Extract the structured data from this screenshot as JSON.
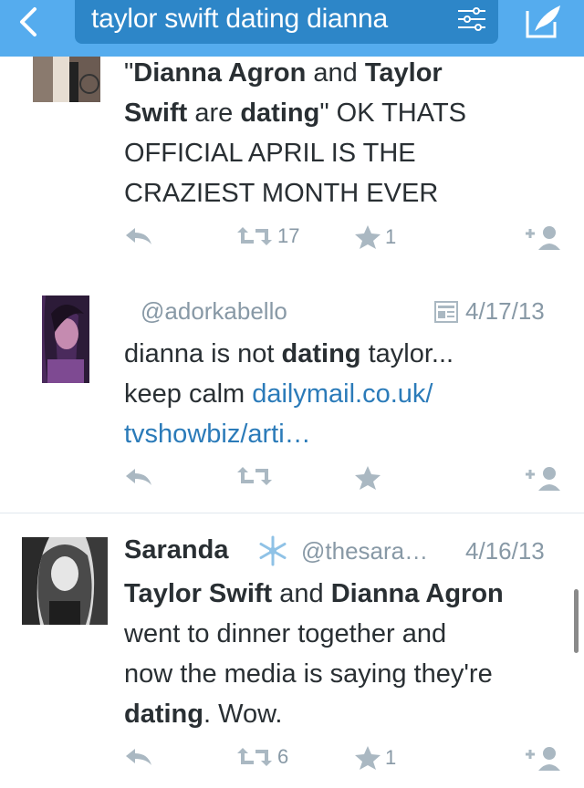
{
  "search": {
    "query": "taylor swift dating dianna"
  },
  "tweets": [
    {
      "line1_a": "\"",
      "line1_b": "Dianna Agron",
      "line1_c": " and ",
      "line1_d": "Taylor",
      "line2_a": "Swift",
      "line2_b": " are ",
      "line2_c": "dating",
      "line2_d": "\" OK THATS",
      "line3": "OFFICIAL APRIL IS THE",
      "line4": "CRAZIEST MONTH EVER",
      "retweets": "17",
      "favorites": "1"
    },
    {
      "handle": "@adorkabello",
      "date": "4/17/13",
      "line1_a": "dianna is not ",
      "line1_b": "dating",
      "line1_c": " taylor...",
      "line2_a": "keep calm ",
      "line2_link": "dailymail.co.uk/",
      "line3_link": "tvshowbiz/arti…",
      "retweets": "",
      "favorites": ""
    },
    {
      "name": "Saranda",
      "handle": "@thesara…",
      "date": "4/16/13",
      "line1_a": "Taylor Swift",
      "line1_b": " and ",
      "line1_c": "Dianna Agron",
      "line2": "went to dinner together and",
      "line3": "now the media is saying they're",
      "line4_a": "dating",
      "line4_b": ". Wow.",
      "retweets": "6",
      "favorites": "1"
    }
  ],
  "colors": {
    "header": "#55acee",
    "search_bg": "#2d86c8",
    "link": "#2b7bb9",
    "muted": "#8899a6",
    "text": "#292f33"
  }
}
